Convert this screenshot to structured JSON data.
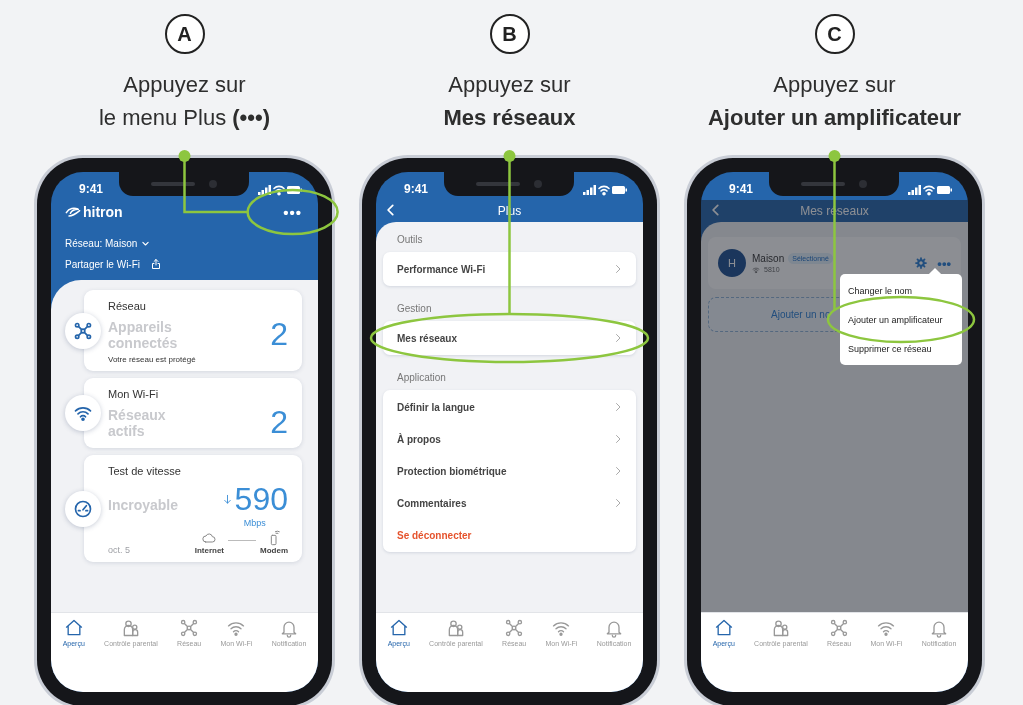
{
  "steps": [
    {
      "badge": "A",
      "caption": "Appuyez sur\nle menu Plus **(•••)**",
      "screen": {
        "kind": "home",
        "time": "9:41",
        "brand": "hitron",
        "more_button": {
          "label": "•••",
          "highlighted": true
        },
        "network_selector": "Réseau: Maison",
        "share_link": "Partager le Wi-Fi",
        "cards": [
          {
            "kind": "devices",
            "title": "Réseau",
            "label": "Appareils connectés",
            "value": "2",
            "note": "Votre réseau est protégé"
          },
          {
            "kind": "wifi",
            "title": "Mon Wi-Fi",
            "label": "Réseaux actifs",
            "value": "2"
          },
          {
            "kind": "speed",
            "title": "Test de vitesse",
            "label": "Incroyable",
            "value": "590",
            "unit": "Mbps",
            "date": "oct. 5",
            "source": "Internet",
            "target": "Modem"
          }
        ],
        "tab_bar": [
          {
            "label": "Aperçu",
            "selected": true
          },
          {
            "label": "Contrôle parental",
            "selected": false
          },
          {
            "label": "Réseau",
            "selected": false
          },
          {
            "label": "Mon Wi-Fi",
            "selected": false
          },
          {
            "label": "Notification",
            "selected": false
          }
        ]
      }
    },
    {
      "badge": "B",
      "caption": "Appuyez sur\n**Mes réseaux**",
      "screen": {
        "kind": "menu",
        "time": "9:41",
        "title": "Plus",
        "sections": [
          {
            "heading": "Outils",
            "items": [
              {
                "kind": "link",
                "label": "Performance Wi-Fi",
                "highlighted": false
              }
            ]
          },
          {
            "heading": "Gestion",
            "items": [
              {
                "kind": "link",
                "label": "Mes réseaux",
                "highlighted": true
              }
            ]
          },
          {
            "heading": "Application",
            "items": [
              {
                "kind": "link",
                "label": "Définir la langue",
                "highlighted": false
              },
              {
                "kind": "link",
                "label": "À propos",
                "highlighted": false
              },
              {
                "kind": "link",
                "label": "Protection biométrique",
                "highlighted": false
              },
              {
                "kind": "link",
                "label": "Commentaires",
                "highlighted": false
              },
              {
                "kind": "danger",
                "label": "Se déconnecter",
                "highlighted": false
              }
            ]
          }
        ],
        "tab_bar": [
          {
            "label": "Aperçu",
            "selected": true
          },
          {
            "label": "Contrôle parental",
            "selected": false
          },
          {
            "label": "Réseau",
            "selected": false
          },
          {
            "label": "Mon Wi-Fi",
            "selected": false
          },
          {
            "label": "Notification",
            "selected": false
          }
        ]
      }
    },
    {
      "badge": "C",
      "caption": "Appuyez sur\n**Ajouter un amplificateur**",
      "screen": {
        "kind": "networks",
        "time": "9:41",
        "title": "Mes réseaux",
        "dimmed": true,
        "network": {
          "initial": "H",
          "name": "Maison",
          "badge": "Sélectionné",
          "ssid": "5810",
          "more_button": "•••"
        },
        "add_button": "Ajouter un no",
        "menu": [
          {
            "label": "Changer le nom",
            "highlighted": false
          },
          {
            "label": "Ajouter un amplificateur",
            "highlighted": true
          },
          {
            "label": "Supprimer ce réseau",
            "highlighted": false
          }
        ],
        "tab_bar": [
          {
            "label": "Aperçu",
            "selected": true
          },
          {
            "label": "Contrôle parental",
            "selected": false
          },
          {
            "label": "Réseau",
            "selected": false
          },
          {
            "label": "Mon Wi-Fi",
            "selected": false
          },
          {
            "label": "Notification",
            "selected": false
          }
        ]
      }
    }
  ]
}
